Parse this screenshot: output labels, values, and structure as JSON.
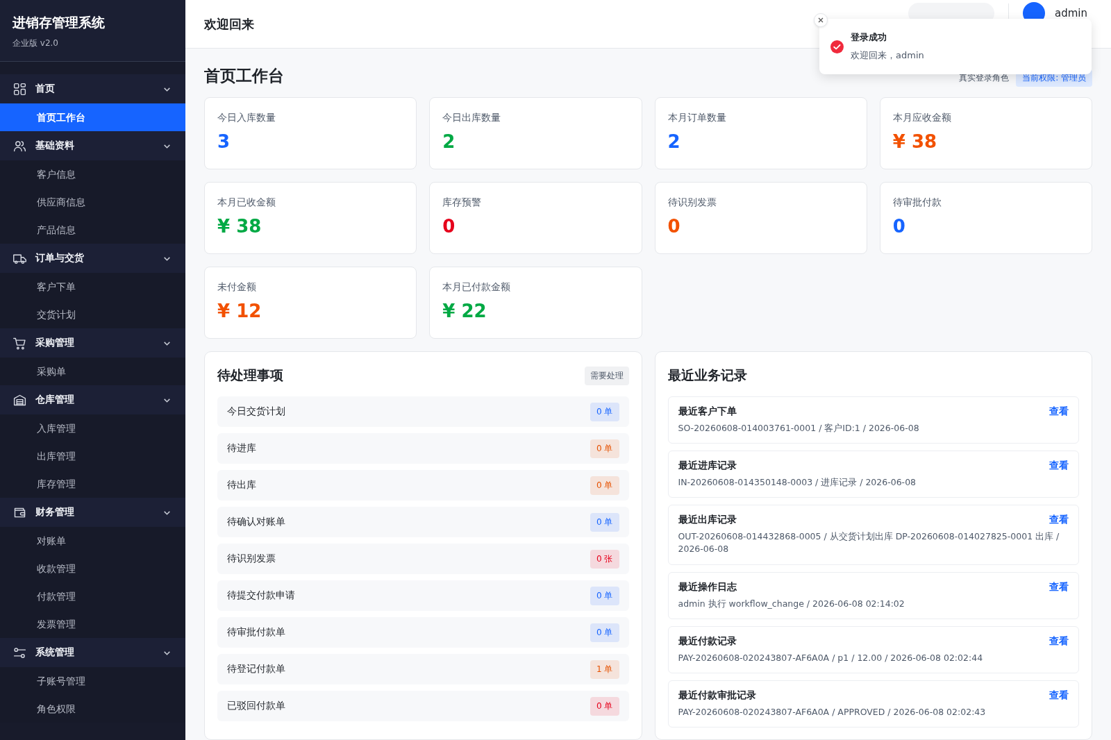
{
  "sidebar": {
    "title": "进销存管理系统",
    "subtitle": "企业版 v2.0",
    "groups": [
      {
        "label": "首页",
        "expanded": true,
        "items": [
          {
            "label": "首页工作台",
            "selected": true
          }
        ]
      },
      {
        "label": "基础资料",
        "expanded": true,
        "items": [
          {
            "label": "客户信息",
            "selected": false
          },
          {
            "label": "供应商信息",
            "selected": false
          },
          {
            "label": "产品信息",
            "selected": false
          }
        ]
      },
      {
        "label": "订单与交货",
        "expanded": true,
        "items": [
          {
            "label": "客户下单",
            "selected": false
          },
          {
            "label": "交货计划",
            "selected": false
          }
        ]
      },
      {
        "label": "采购管理",
        "expanded": true,
        "items": [
          {
            "label": "采购单",
            "selected": false
          }
        ]
      },
      {
        "label": "仓库管理",
        "expanded": true,
        "items": [
          {
            "label": "入库管理",
            "selected": false
          },
          {
            "label": "出库管理",
            "selected": false
          },
          {
            "label": "库存管理",
            "selected": false
          }
        ]
      },
      {
        "label": "财务管理",
        "expanded": true,
        "items": [
          {
            "label": "对账单",
            "selected": false
          },
          {
            "label": "收款管理",
            "selected": false
          },
          {
            "label": "付款管理",
            "selected": false
          },
          {
            "label": "发票管理",
            "selected": false
          }
        ]
      },
      {
        "label": "系统管理",
        "expanded": true,
        "items": [
          {
            "label": "子账号管理",
            "selected": false
          },
          {
            "label": "角色权限",
            "selected": false
          }
        ]
      }
    ]
  },
  "header": {
    "title": "欢迎回来",
    "user": "admin"
  },
  "toast": {
    "title": "登录成功",
    "message": "欢迎回来，admin"
  },
  "page": {
    "title": "首页工作台",
    "role_label": "真实登录角色",
    "role_badge": "当前权限: 管理员"
  },
  "stats": [
    {
      "label": "今日入库数量",
      "value": "3",
      "color": "#1664ff"
    },
    {
      "label": "今日出库数量",
      "value": "2",
      "color": "#00a944"
    },
    {
      "label": "本月订单数量",
      "value": "2",
      "color": "#1664ff"
    },
    {
      "label": "本月应收金额",
      "value": "¥ 38",
      "color": "#f25100"
    },
    {
      "label": "本月已收金额",
      "value": "¥ 38",
      "color": "#00a944"
    },
    {
      "label": "库存预警",
      "value": "0",
      "color": "#e6001b"
    },
    {
      "label": "待识别发票",
      "value": "0",
      "color": "#f25100"
    },
    {
      "label": "待审批付款",
      "value": "0",
      "color": "#1664ff"
    },
    {
      "label": "未付金额",
      "value": "¥ 12",
      "color": "#f25100"
    },
    {
      "label": "本月已付款金额",
      "value": "¥ 22",
      "color": "#00a944"
    }
  ],
  "todo": {
    "title": "待处理事项",
    "tag": "需要处理",
    "items": [
      {
        "label": "今日交货计划",
        "count": "0 单",
        "color": "#1664ff"
      },
      {
        "label": "待进库",
        "count": "0 单",
        "color": "#e65100"
      },
      {
        "label": "待出库",
        "count": "0 单",
        "color": "#e65100"
      },
      {
        "label": "待确认对账单",
        "count": "0 单",
        "color": "#1664ff"
      },
      {
        "label": "待识别发票",
        "count": "0 张",
        "color": "#e6001b"
      },
      {
        "label": "待提交付款申请",
        "count": "0 单",
        "color": "#1664ff"
      },
      {
        "label": "待审批付款单",
        "count": "0 单",
        "color": "#1664ff"
      },
      {
        "label": "待登记付款单",
        "count": "1 单",
        "color": "#e65100"
      },
      {
        "label": "已驳回付款单",
        "count": "0 单",
        "color": "#e6001b"
      }
    ]
  },
  "recent": {
    "title": "最近业务记录",
    "items": [
      {
        "title": "最近客户下单",
        "detail": "SO-20260608-014003761-0001 / 客户ID:1 / 2026-06-08",
        "link": "查看"
      },
      {
        "title": "最近进库记录",
        "detail": "IN-20260608-014350148-0003 / 进库记录 / 2026-06-08",
        "link": "查看"
      },
      {
        "title": "最近出库记录",
        "detail": "OUT-20260608-014432868-0005 / 从交货计划出库 DP-20260608-014027825-0001 出库 / 2026-06-08",
        "link": "查看"
      },
      {
        "title": "最近操作日志",
        "detail": "admin 执行 workflow_change / 2026-06-08 02:14:02",
        "link": "查看"
      },
      {
        "title": "最近付款记录",
        "detail": "PAY-20260608-020243807-AF6A0A / p1 / 12.00 / 2026-06-08 02:02:44",
        "link": "查看"
      },
      {
        "title": "最近付款审批记录",
        "detail": "PAY-20260608-020243807-AF6A0A / APPROVED / 2026-06-08 02:02:43",
        "link": "查看"
      }
    ]
  }
}
